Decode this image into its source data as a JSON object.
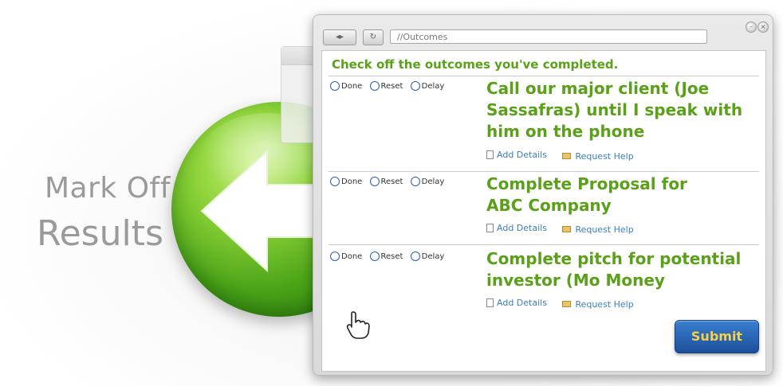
{
  "hero": {
    "line1": "Mark Off",
    "line2": "Results"
  },
  "browser": {
    "address": "//Outcomes",
    "back_forward_icon": "back-forward-arrows",
    "refresh_icon": "refresh-icon"
  },
  "form": {
    "instructions": "Check off the outcomes you've completed.",
    "radio_labels": {
      "done": "Done",
      "reset": "Reset",
      "delay": "Delay"
    },
    "tasks": [
      {
        "title": "Call our major client (Joe Sassafras) until I speak with him on the phone",
        "add_details": "Add Details",
        "request_help": "Request Help"
      },
      {
        "title": "Complete Proposal for ABC Company",
        "add_details": "Add Details",
        "request_help": "Request Help"
      },
      {
        "title": "Complete pitch for potential investor (Mo Money",
        "add_details": "Add Details",
        "request_help": "Request Help"
      }
    ],
    "submit_label": "Submit"
  },
  "colors": {
    "green": "#5aa018",
    "link_blue": "#3e7fb8",
    "submit_bg": "#2a63b5",
    "submit_text": "#f3d24a"
  }
}
